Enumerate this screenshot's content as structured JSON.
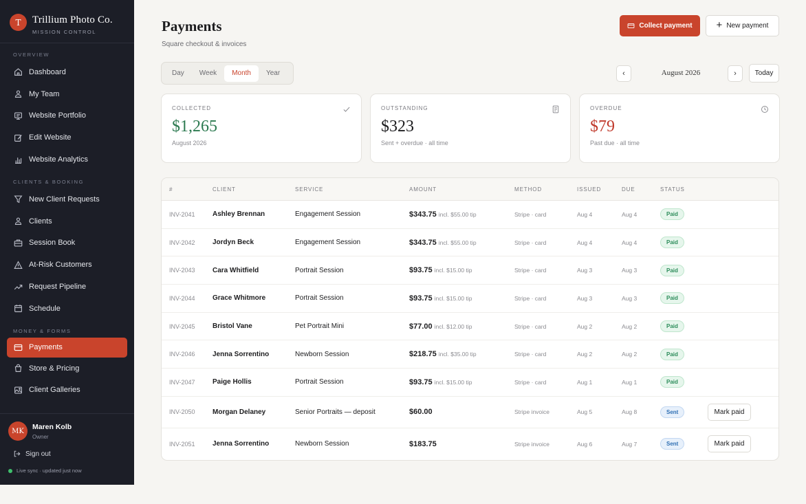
{
  "brand": {
    "initial": "T",
    "name": "Trillium Photo Co.",
    "subtitle": "MISSION CONTROL"
  },
  "sidebar": {
    "sections": [
      {
        "label": "OVERVIEW",
        "items": [
          {
            "label": "Dashboard",
            "icon": "home-icon"
          },
          {
            "label": "My Team",
            "icon": "users-icon"
          },
          {
            "label": "Website Portfolio",
            "icon": "portfolio-icon"
          },
          {
            "label": "Edit Website",
            "icon": "edit-icon"
          },
          {
            "label": "Website Analytics",
            "icon": "analytics-icon"
          }
        ]
      },
      {
        "label": "CLIENTS & BOOKING",
        "items": [
          {
            "label": "New Client Requests",
            "icon": "filter-icon"
          },
          {
            "label": "Clients",
            "icon": "users-icon"
          },
          {
            "label": "Session Book",
            "icon": "briefcase-icon"
          },
          {
            "label": "At-Risk Customers",
            "icon": "warning-icon"
          },
          {
            "label": "Request Pipeline",
            "icon": "trend-icon"
          },
          {
            "label": "Schedule",
            "icon": "calendar-icon"
          }
        ]
      },
      {
        "label": "MONEY & FORMS",
        "items": [
          {
            "label": "Payments",
            "icon": "card-icon",
            "active": true
          },
          {
            "label": "Store & Pricing",
            "icon": "bag-icon"
          },
          {
            "label": "Client Galleries",
            "icon": "image-icon"
          }
        ]
      }
    ]
  },
  "user": {
    "initials": "MK",
    "name": "Maren Kolb",
    "role": "Owner"
  },
  "signout_label": "Sign out",
  "sync_label": "Live sync · updated just now",
  "header": {
    "title": "Payments",
    "subtitle": "Square checkout & invoices",
    "collect_label": "Collect payment",
    "new_label": "New payment"
  },
  "periods": [
    "Day",
    "Week",
    "Month",
    "Year"
  ],
  "active_period": "Month",
  "period_label": "August 2026",
  "today_label": "Today",
  "prev_glyph": "‹",
  "next_glyph": "›",
  "cards": [
    {
      "label": "COLLECTED",
      "value": "$1,265",
      "sub": "August 2026",
      "color": "#2c7a50",
      "icon": "check-icon"
    },
    {
      "label": "OUTSTANDING",
      "value": "$323",
      "sub": "Sent + overdue · all time",
      "color": "#1d1d1f",
      "icon": "document-icon"
    },
    {
      "label": "OVERDUE",
      "value": "$79",
      "sub": "Past due · all time",
      "color": "#c0392b",
      "icon": "clock-icon"
    }
  ],
  "table": {
    "headers": [
      "#",
      "CLIENT",
      "SERVICE",
      "AMOUNT",
      "METHOD",
      "ISSUED",
      "DUE",
      "STATUS"
    ],
    "rows": [
      {
        "id": "INV-2041",
        "client": "Ashley Brennan",
        "service": "Engagement Session",
        "amount": "$343.75",
        "tip": "incl. $55.00 tip",
        "method": "Stripe · card",
        "issued": "Aug 4",
        "due": "Aug 4",
        "status": "Paid"
      },
      {
        "id": "INV-2042",
        "client": "Jordyn Beck",
        "service": "Engagement Session",
        "amount": "$343.75",
        "tip": "incl. $55.00 tip",
        "method": "Stripe · card",
        "issued": "Aug 4",
        "due": "Aug 4",
        "status": "Paid"
      },
      {
        "id": "INV-2043",
        "client": "Cara Whitfield",
        "service": "Portrait Session",
        "amount": "$93.75",
        "tip": "incl. $15.00 tip",
        "method": "Stripe · card",
        "issued": "Aug 3",
        "due": "Aug 3",
        "status": "Paid"
      },
      {
        "id": "INV-2044",
        "client": "Grace Whitmore",
        "service": "Portrait Session",
        "amount": "$93.75",
        "tip": "incl. $15.00 tip",
        "method": "Stripe · card",
        "issued": "Aug 3",
        "due": "Aug 3",
        "status": "Paid"
      },
      {
        "id": "INV-2045",
        "client": "Bristol Vane",
        "service": "Pet Portrait Mini",
        "amount": "$77.00",
        "tip": "incl. $12.00 tip",
        "method": "Stripe · card",
        "issued": "Aug 2",
        "due": "Aug 2",
        "status": "Paid"
      },
      {
        "id": "INV-2046",
        "client": "Jenna Sorrentino",
        "service": "Newborn Session",
        "amount": "$218.75",
        "tip": "incl. $35.00 tip",
        "method": "Stripe · card",
        "issued": "Aug 2",
        "due": "Aug 2",
        "status": "Paid"
      },
      {
        "id": "INV-2047",
        "client": "Paige Hollis",
        "service": "Portrait Session",
        "amount": "$93.75",
        "tip": "incl. $15.00 tip",
        "method": "Stripe · card",
        "issued": "Aug 1",
        "due": "Aug 1",
        "status": "Paid"
      },
      {
        "id": "INV-2050",
        "client": "Morgan Delaney",
        "service": "Senior Portraits — deposit",
        "amount": "$60.00",
        "tip": "",
        "method": "Stripe invoice",
        "issued": "Aug 5",
        "due": "Aug 8",
        "status": "Sent",
        "action": "Mark paid"
      },
      {
        "id": "INV-2051",
        "client": "Jenna Sorrentino",
        "service": "Newborn Session",
        "amount": "$183.75",
        "tip": "",
        "method": "Stripe invoice",
        "issued": "Aug 6",
        "due": "Aug 7",
        "status": "Sent",
        "action": "Mark paid"
      }
    ]
  }
}
